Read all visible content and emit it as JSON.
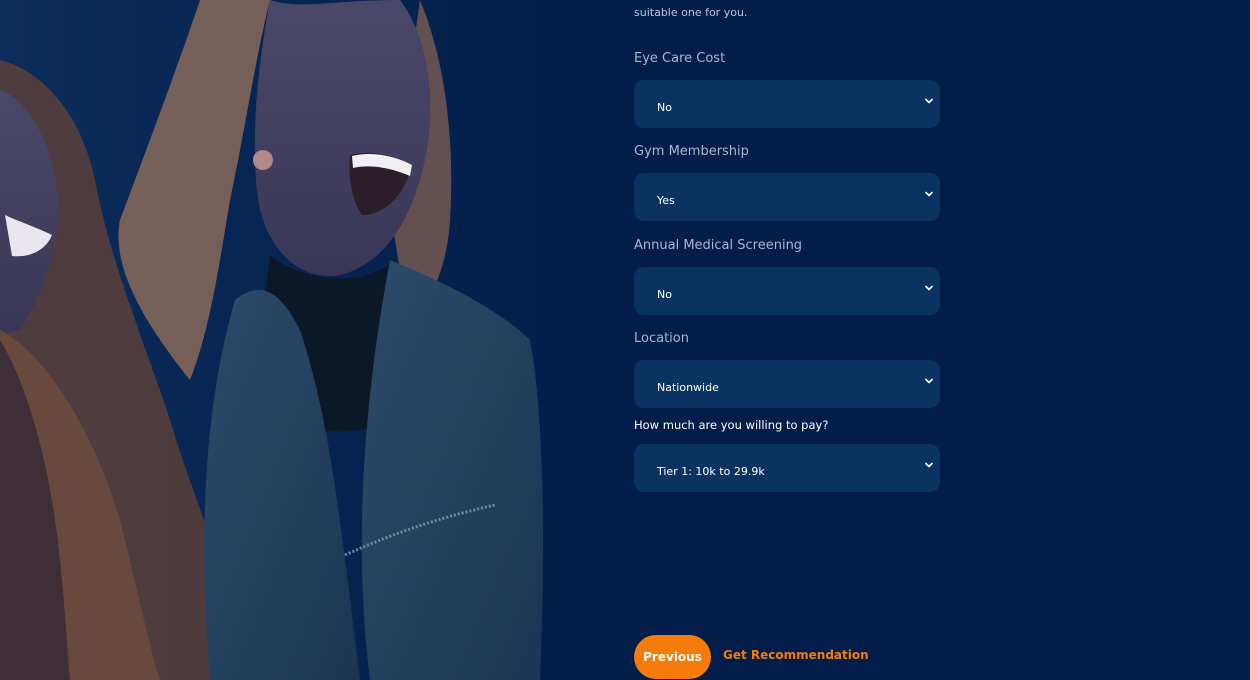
{
  "intro_text": "suitable one for you.",
  "fields": [
    {
      "label": "Eye Care Cost",
      "value": "No"
    },
    {
      "label": "Gym Membership",
      "value": "Yes"
    },
    {
      "label": "Annual Medical Screening",
      "value": "No"
    },
    {
      "label": "Location",
      "value": "Nationwide"
    },
    {
      "label": "How much are you willing to pay?",
      "value": "Tier 1: 10k to 29.9k"
    }
  ],
  "actions": {
    "previous_label": "Previous",
    "recommend_label": "Get Recommendation"
  },
  "colors": {
    "background": "#021d4a",
    "select_bg": "#0a3362",
    "accent": "#f57b0a"
  },
  "icons": {
    "select_chevron": "chevron-down-icon"
  }
}
